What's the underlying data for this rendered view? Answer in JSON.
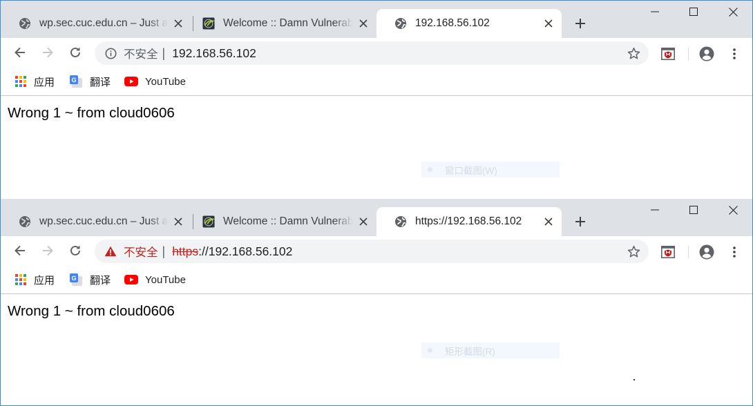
{
  "windows": [
    {
      "tabs": [
        {
          "title": "wp.sec.cuc.edu.cn – Just another WordPress site",
          "icon": "globe-icon"
        },
        {
          "title": "Welcome :: Damn Vulnerable Web Application (DVWA)",
          "icon": "dvwa-icon"
        },
        {
          "title": "192.168.56.102",
          "icon": "globe-icon"
        }
      ],
      "address": {
        "security_icon": "info-icon",
        "security_text": "不安全",
        "separator": "|",
        "url_scheme": "",
        "url_rest": "192.168.56.102"
      },
      "bookmarks": [
        {
          "label": "应用",
          "icon": "apps-grid-icon"
        },
        {
          "label": "翻译",
          "icon": "google-translate-icon"
        },
        {
          "label": "YouTube",
          "icon": "youtube-icon"
        }
      ],
      "content_text": "Wrong 1 ~ from cloud0606",
      "ghost_menu_text": "窗口截图(W)"
    },
    {
      "tabs": [
        {
          "title": "wp.sec.cuc.edu.cn – Just another WordPress site",
          "icon": "globe-icon"
        },
        {
          "title": "Welcome :: Damn Vulnerable Web Application (DVWA)",
          "icon": "dvwa-icon"
        },
        {
          "title": "https://192.168.56.102",
          "icon": "globe-icon"
        }
      ],
      "address": {
        "security_icon": "warning-triangle-icon",
        "security_text": "不安全",
        "separator": "|",
        "url_scheme": "https",
        "url_rest": "://192.168.56.102"
      },
      "bookmarks": [
        {
          "label": "应用",
          "icon": "apps-grid-icon"
        },
        {
          "label": "翻译",
          "icon": "google-translate-icon"
        },
        {
          "label": "YouTube",
          "icon": "youtube-icon"
        }
      ],
      "content_text": "Wrong 1 ~ from cloud0606",
      "ghost_menu_text": "矩形截图(R)"
    }
  ],
  "colors": {
    "tabstrip": "#dee1e6",
    "omnibox": "#f1f3f4",
    "danger": "#c5221f",
    "window_border": "#3b8ad9"
  }
}
